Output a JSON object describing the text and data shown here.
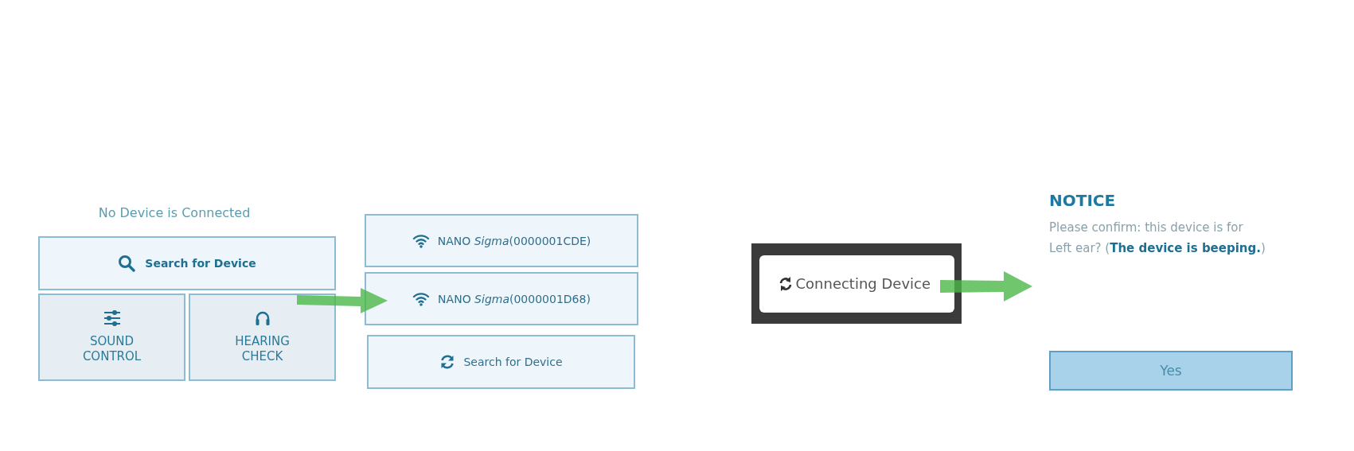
{
  "home": {
    "status": "No Device is Connected",
    "search_button": "Search for Device",
    "tiles": [
      {
        "kind": "sliders",
        "label": "SOUND CONTROL"
      },
      {
        "kind": "headphones",
        "label": "HEARING CHECK"
      }
    ]
  },
  "device_list": {
    "devices": [
      {
        "name": "NANO *Sigma*(0000001CDE)"
      },
      {
        "name": "NANO *Sigma*(0000001D68)"
      }
    ],
    "search_button": "Search for Device"
  },
  "connecting": {
    "label": "Connecting Device"
  },
  "notice": {
    "title": "NOTICE",
    "message": "Please confirm: this device is for Left ear? (**The device is beeping.**)",
    "button": "Yes"
  }
}
